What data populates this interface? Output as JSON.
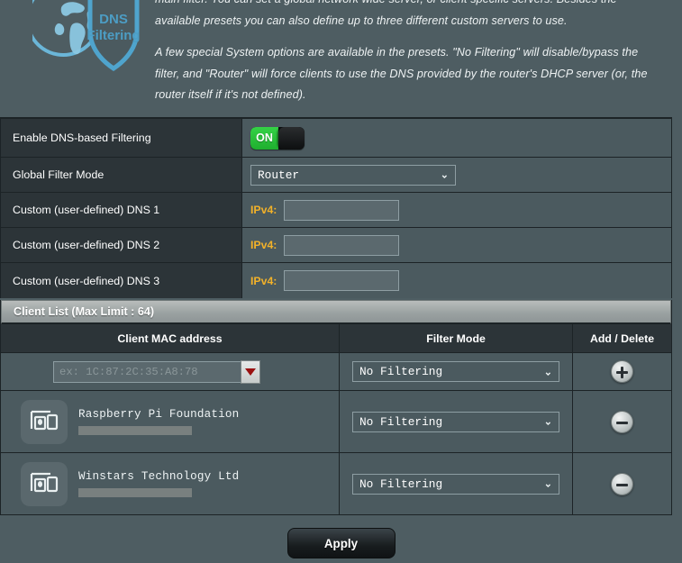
{
  "logo": {
    "alt": "dns-filtering-shield-logo",
    "line1": "DNS",
    "line2": "Filtering",
    "color": "#54a8cf"
  },
  "intro": {
    "paragraph1": "main filter. You can set a global network wide server, or client specific servers. Besides the available presets you can also define up to three different custom servers to use.",
    "paragraph2": "A few special System options are available in the presets. \"No Filtering\" will disable/bypass the filter, and \"Router\" will force clients to use the DNS provided by the router's DHCP server (or, the router itself if it's not defined)."
  },
  "settings": {
    "enable_label": "Enable DNS-based Filtering",
    "enable_state": "ON",
    "global_mode_label": "Global Filter Mode",
    "global_mode_value": "Router",
    "global_mode_options": [
      "Router",
      "No Filtering"
    ],
    "dns1_label": "Custom (user-defined) DNS 1",
    "dns2_label": "Custom (user-defined) DNS 2",
    "dns3_label": "Custom (user-defined) DNS 3",
    "ipv4_label": "IPv4:",
    "dns1_value": "",
    "dns2_value": "",
    "dns3_value": ""
  },
  "client_list": {
    "title": "Client List (Max Limit : 64)",
    "columns": {
      "mac": "Client MAC address",
      "mode": "Filter Mode",
      "action": "Add / Delete"
    },
    "new_row": {
      "mac_placeholder": "ex: 1C:87:2C:35:A8:78",
      "mac_value": "",
      "filter_mode": "No Filtering",
      "action": "add"
    },
    "rows": [
      {
        "device_icon": "device-icon",
        "name": "Raspberry Pi Foundation",
        "mac_redacted": true,
        "filter_mode": "No Filtering",
        "action": "delete"
      },
      {
        "device_icon": "device-icon",
        "name": "Winstars Technology Ltd",
        "mac_redacted": true,
        "filter_mode": "No Filtering",
        "action": "delete"
      }
    ],
    "filter_mode_options": [
      "No Filtering",
      "Router"
    ]
  },
  "footer": {
    "apply_label": "Apply"
  },
  "colors": {
    "page_bg": "#4e5d62",
    "label_bg": "#2c3438",
    "value_bg": "#4b5a5f",
    "border": "#1c2326",
    "accent_on": "#2cbf3a",
    "ipv4_label": "#f3b229",
    "logo_blue": "#54a8cf"
  }
}
